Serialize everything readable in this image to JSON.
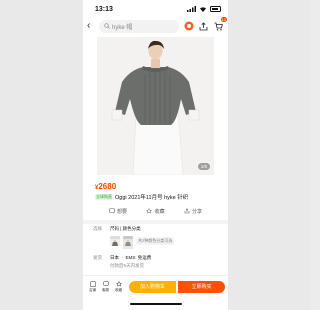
{
  "status": {
    "time": "13:13"
  },
  "search": {
    "placeholder": "hyke 帽"
  },
  "cart": {
    "badge": "10"
  },
  "gallery": {
    "counter": "1/8"
  },
  "product": {
    "currency": "¥",
    "price": "2680",
    "tag": "全球购直",
    "title": "Oggi 2021年11月号 hyke 针织"
  },
  "actions": {
    "want": "想要",
    "favorite": "收藏",
    "share": "分享"
  },
  "options": {
    "select_key": "选择",
    "select_value": "尺码 | 颜色分类",
    "thumb_tag": "共2种颜色分类可选",
    "ship_key": "发货",
    "ship_from": "日本",
    "ship_method": "EMS: 免运费",
    "ship_note": "付款后5天内发货"
  },
  "bottom": {
    "shop": "店铺",
    "service": "客服",
    "collect": "收藏",
    "add_cart": "加入购物车",
    "buy_now": "立即购买"
  },
  "colors": {
    "accent": "#ff4400",
    "cart_btn": "#ffb000",
    "buy_btn": "#ff5000"
  }
}
